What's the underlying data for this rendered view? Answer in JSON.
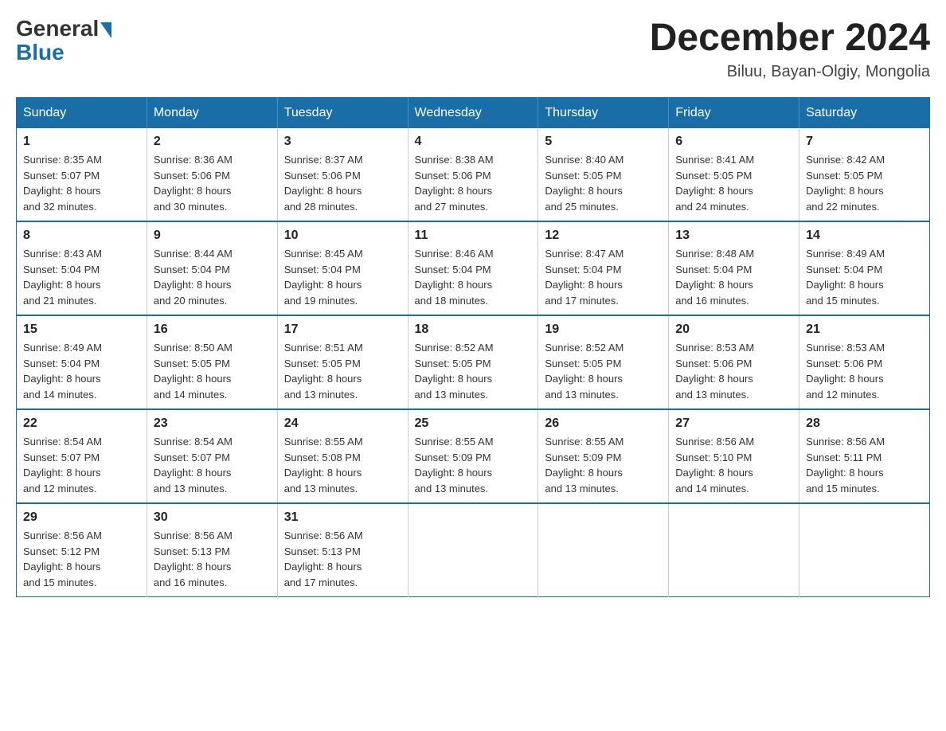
{
  "header": {
    "logo": {
      "general": "General",
      "blue": "Blue"
    },
    "title": "December 2024",
    "location": "Biluu, Bayan-Olgiy, Mongolia"
  },
  "weekdays": [
    "Sunday",
    "Monday",
    "Tuesday",
    "Wednesday",
    "Thursday",
    "Friday",
    "Saturday"
  ],
  "weeks": [
    [
      {
        "day": "1",
        "sunrise": "8:35 AM",
        "sunset": "5:07 PM",
        "daylight": "8 hours and 32 minutes."
      },
      {
        "day": "2",
        "sunrise": "8:36 AM",
        "sunset": "5:06 PM",
        "daylight": "8 hours and 30 minutes."
      },
      {
        "day": "3",
        "sunrise": "8:37 AM",
        "sunset": "5:06 PM",
        "daylight": "8 hours and 28 minutes."
      },
      {
        "day": "4",
        "sunrise": "8:38 AM",
        "sunset": "5:06 PM",
        "daylight": "8 hours and 27 minutes."
      },
      {
        "day": "5",
        "sunrise": "8:40 AM",
        "sunset": "5:05 PM",
        "daylight": "8 hours and 25 minutes."
      },
      {
        "day": "6",
        "sunrise": "8:41 AM",
        "sunset": "5:05 PM",
        "daylight": "8 hours and 24 minutes."
      },
      {
        "day": "7",
        "sunrise": "8:42 AM",
        "sunset": "5:05 PM",
        "daylight": "8 hours and 22 minutes."
      }
    ],
    [
      {
        "day": "8",
        "sunrise": "8:43 AM",
        "sunset": "5:04 PM",
        "daylight": "8 hours and 21 minutes."
      },
      {
        "day": "9",
        "sunrise": "8:44 AM",
        "sunset": "5:04 PM",
        "daylight": "8 hours and 20 minutes."
      },
      {
        "day": "10",
        "sunrise": "8:45 AM",
        "sunset": "5:04 PM",
        "daylight": "8 hours and 19 minutes."
      },
      {
        "day": "11",
        "sunrise": "8:46 AM",
        "sunset": "5:04 PM",
        "daylight": "8 hours and 18 minutes."
      },
      {
        "day": "12",
        "sunrise": "8:47 AM",
        "sunset": "5:04 PM",
        "daylight": "8 hours and 17 minutes."
      },
      {
        "day": "13",
        "sunrise": "8:48 AM",
        "sunset": "5:04 PM",
        "daylight": "8 hours and 16 minutes."
      },
      {
        "day": "14",
        "sunrise": "8:49 AM",
        "sunset": "5:04 PM",
        "daylight": "8 hours and 15 minutes."
      }
    ],
    [
      {
        "day": "15",
        "sunrise": "8:49 AM",
        "sunset": "5:04 PM",
        "daylight": "8 hours and 14 minutes."
      },
      {
        "day": "16",
        "sunrise": "8:50 AM",
        "sunset": "5:05 PM",
        "daylight": "8 hours and 14 minutes."
      },
      {
        "day": "17",
        "sunrise": "8:51 AM",
        "sunset": "5:05 PM",
        "daylight": "8 hours and 13 minutes."
      },
      {
        "day": "18",
        "sunrise": "8:52 AM",
        "sunset": "5:05 PM",
        "daylight": "8 hours and 13 minutes."
      },
      {
        "day": "19",
        "sunrise": "8:52 AM",
        "sunset": "5:05 PM",
        "daylight": "8 hours and 13 minutes."
      },
      {
        "day": "20",
        "sunrise": "8:53 AM",
        "sunset": "5:06 PM",
        "daylight": "8 hours and 13 minutes."
      },
      {
        "day": "21",
        "sunrise": "8:53 AM",
        "sunset": "5:06 PM",
        "daylight": "8 hours and 12 minutes."
      }
    ],
    [
      {
        "day": "22",
        "sunrise": "8:54 AM",
        "sunset": "5:07 PM",
        "daylight": "8 hours and 12 minutes."
      },
      {
        "day": "23",
        "sunrise": "8:54 AM",
        "sunset": "5:07 PM",
        "daylight": "8 hours and 13 minutes."
      },
      {
        "day": "24",
        "sunrise": "8:55 AM",
        "sunset": "5:08 PM",
        "daylight": "8 hours and 13 minutes."
      },
      {
        "day": "25",
        "sunrise": "8:55 AM",
        "sunset": "5:09 PM",
        "daylight": "8 hours and 13 minutes."
      },
      {
        "day": "26",
        "sunrise": "8:55 AM",
        "sunset": "5:09 PM",
        "daylight": "8 hours and 13 minutes."
      },
      {
        "day": "27",
        "sunrise": "8:56 AM",
        "sunset": "5:10 PM",
        "daylight": "8 hours and 14 minutes."
      },
      {
        "day": "28",
        "sunrise": "8:56 AM",
        "sunset": "5:11 PM",
        "daylight": "8 hours and 15 minutes."
      }
    ],
    [
      {
        "day": "29",
        "sunrise": "8:56 AM",
        "sunset": "5:12 PM",
        "daylight": "8 hours and 15 minutes."
      },
      {
        "day": "30",
        "sunrise": "8:56 AM",
        "sunset": "5:13 PM",
        "daylight": "8 hours and 16 minutes."
      },
      {
        "day": "31",
        "sunrise": "8:56 AM",
        "sunset": "5:13 PM",
        "daylight": "8 hours and 17 minutes."
      },
      null,
      null,
      null,
      null
    ]
  ],
  "labels": {
    "sunrise": "Sunrise:",
    "sunset": "Sunset:",
    "daylight": "Daylight:"
  }
}
